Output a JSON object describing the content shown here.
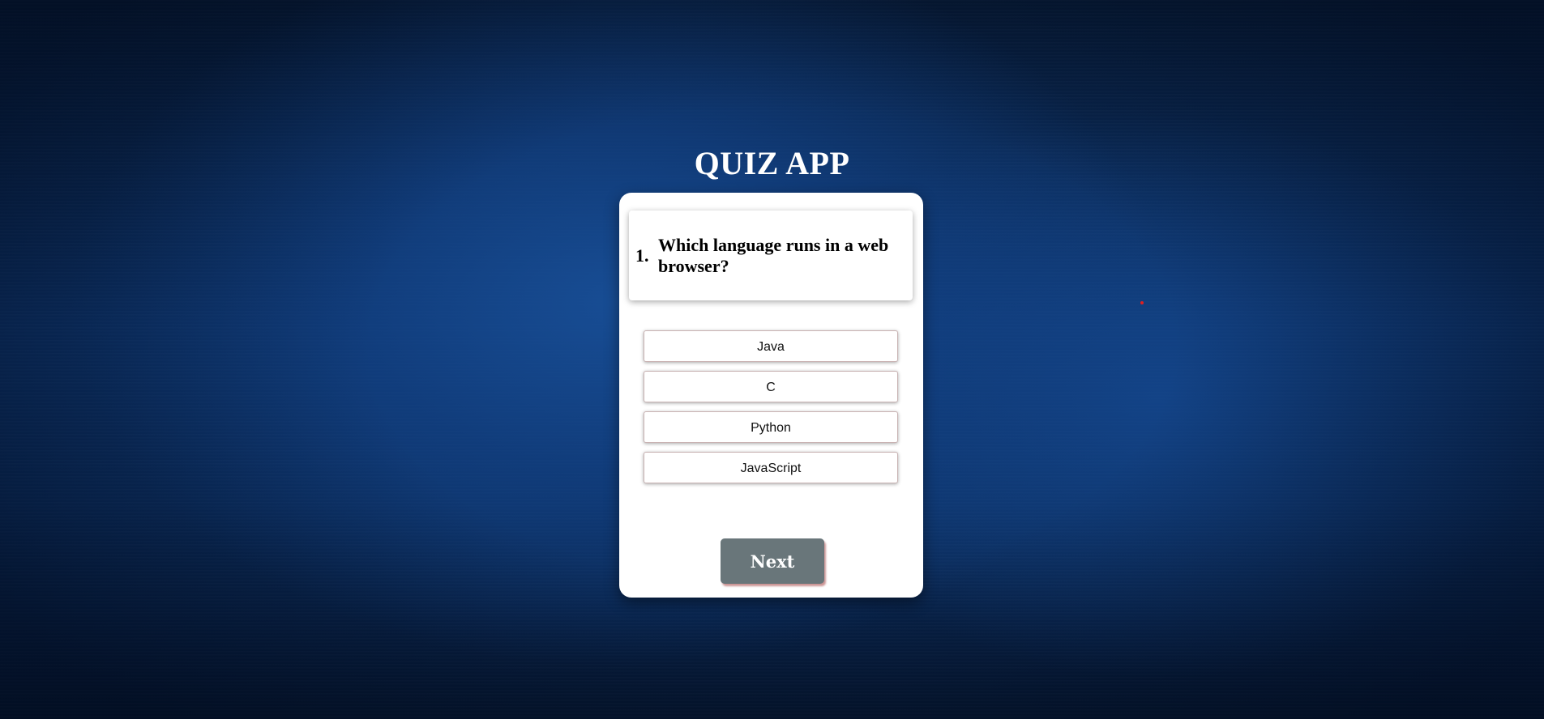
{
  "app": {
    "title": "QUIZ APP"
  },
  "question": {
    "number": "1.",
    "text": "Which language runs in a web browser?"
  },
  "answers": [
    {
      "label": "Java"
    },
    {
      "label": "C"
    },
    {
      "label": "Python"
    },
    {
      "label": "JavaScript"
    }
  ],
  "controls": {
    "next_label": "Next"
  },
  "colors": {
    "background": "#0d3670",
    "card": "#ffffff",
    "next_button": "#69767a",
    "cursor_dot": "#e02020"
  }
}
